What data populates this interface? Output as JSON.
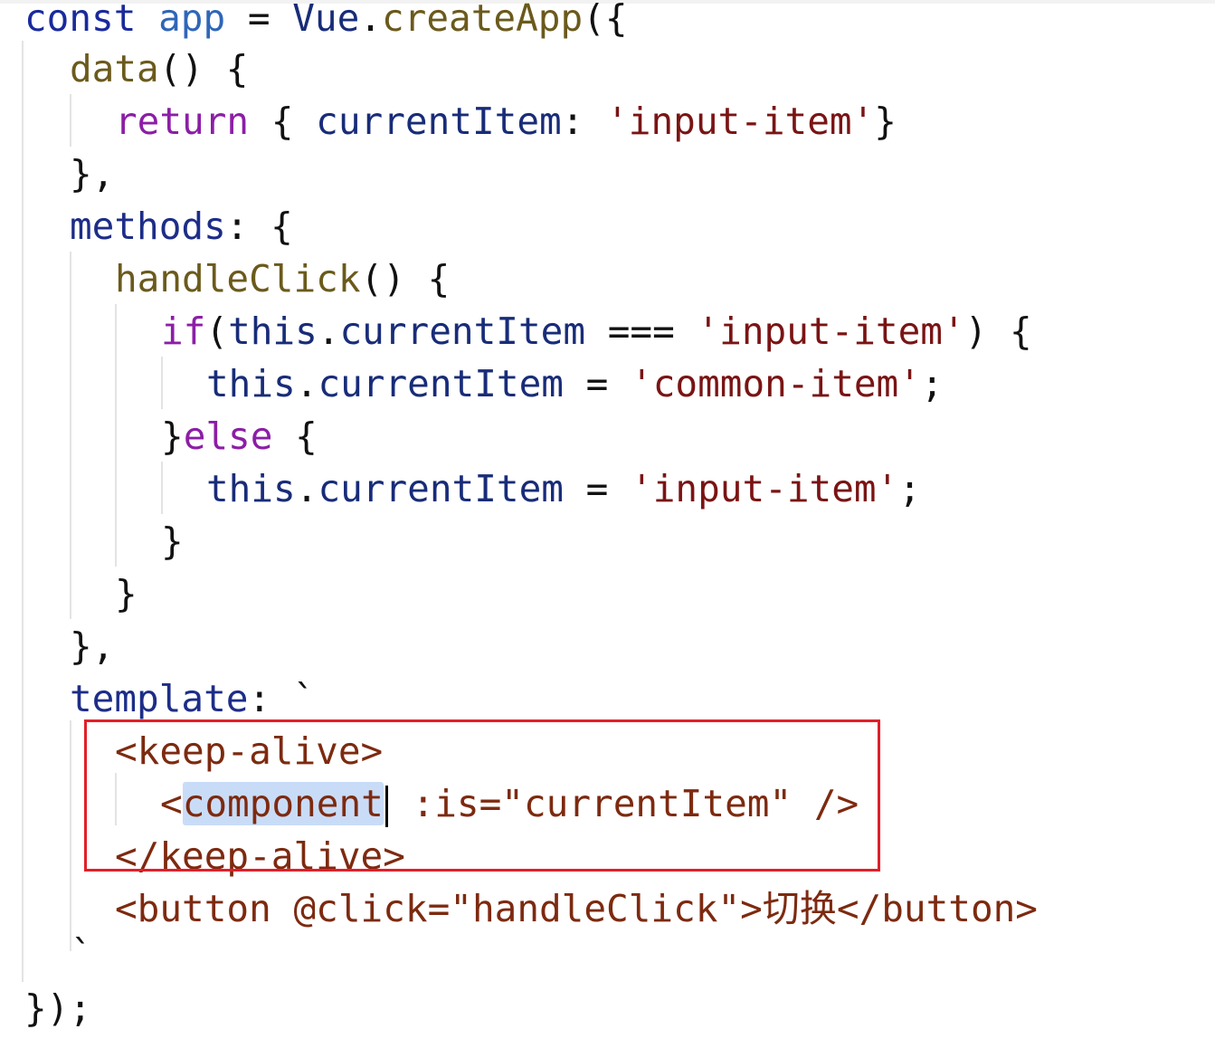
{
  "code": {
    "lines": [
      {
        "id": 1,
        "tokens": [
          {
            "t": "const",
            "c": "kw"
          },
          {
            "t": " ",
            "c": "punc"
          },
          {
            "t": "app",
            "c": "ident"
          },
          {
            "t": " = ",
            "c": "punc"
          },
          {
            "t": "Vue",
            "c": "obj"
          },
          {
            "t": ".",
            "c": "punc"
          },
          {
            "t": "createApp",
            "c": "fn"
          },
          {
            "t": "({",
            "c": "punc"
          }
        ]
      },
      {
        "id": 2,
        "tokens": [
          {
            "t": "data",
            "c": "fn"
          },
          {
            "t": "() {",
            "c": "punc"
          }
        ]
      },
      {
        "id": 3,
        "tokens": [
          {
            "t": "return",
            "c": "ret"
          },
          {
            "t": " { ",
            "c": "punc"
          },
          {
            "t": "currentItem",
            "c": "obj"
          },
          {
            "t": ": ",
            "c": "punc"
          },
          {
            "t": "'input-item'",
            "c": "str"
          },
          {
            "t": "}",
            "c": "punc"
          }
        ]
      },
      {
        "id": 4,
        "tokens": [
          {
            "t": "},",
            "c": "punc"
          }
        ]
      },
      {
        "id": 5,
        "tokens": [
          {
            "t": "methods",
            "c": "prop"
          },
          {
            "t": ": {",
            "c": "punc"
          }
        ]
      },
      {
        "id": 6,
        "tokens": [
          {
            "t": "handleClick",
            "c": "fn"
          },
          {
            "t": "() {",
            "c": "punc"
          }
        ]
      },
      {
        "id": 7,
        "tokens": [
          {
            "t": "if",
            "c": "ret"
          },
          {
            "t": "(",
            "c": "punc"
          },
          {
            "t": "this",
            "c": "obj"
          },
          {
            "t": ".",
            "c": "punc"
          },
          {
            "t": "currentItem",
            "c": "obj"
          },
          {
            "t": " === ",
            "c": "punc"
          },
          {
            "t": "'input-item'",
            "c": "str"
          },
          {
            "t": ") {",
            "c": "punc"
          }
        ]
      },
      {
        "id": 8,
        "tokens": [
          {
            "t": "this",
            "c": "obj"
          },
          {
            "t": ".",
            "c": "punc"
          },
          {
            "t": "currentItem",
            "c": "obj"
          },
          {
            "t": " = ",
            "c": "punc"
          },
          {
            "t": "'common-item'",
            "c": "str"
          },
          {
            "t": ";",
            "c": "punc"
          }
        ]
      },
      {
        "id": 9,
        "tokens": [
          {
            "t": "}",
            "c": "punc"
          },
          {
            "t": "else",
            "c": "ret"
          },
          {
            "t": " {",
            "c": "punc"
          }
        ]
      },
      {
        "id": 10,
        "tokens": [
          {
            "t": "this",
            "c": "obj"
          },
          {
            "t": ".",
            "c": "punc"
          },
          {
            "t": "currentItem",
            "c": "obj"
          },
          {
            "t": " = ",
            "c": "punc"
          },
          {
            "t": "'input-item'",
            "c": "str"
          },
          {
            "t": ";",
            "c": "punc"
          }
        ]
      },
      {
        "id": 11,
        "tokens": [
          {
            "t": "}",
            "c": "punc"
          }
        ]
      },
      {
        "id": 12,
        "tokens": [
          {
            "t": "}",
            "c": "punc"
          }
        ]
      },
      {
        "id": 13,
        "tokens": [
          {
            "t": "},",
            "c": "punc"
          }
        ]
      },
      {
        "id": 14,
        "tokens": [
          {
            "t": "template",
            "c": "prop"
          },
          {
            "t": ": `",
            "c": "punc"
          }
        ]
      },
      {
        "id": 15,
        "tokens": [
          {
            "t": "<keep-alive>",
            "c": "tag"
          }
        ]
      },
      {
        "id": 16,
        "tokens": [
          {
            "t": "<",
            "c": "tag"
          },
          {
            "t": "component",
            "c": "tag",
            "sel": true,
            "caret": true
          },
          {
            "t": " :is=\"currentItem\" />",
            "c": "tag"
          }
        ]
      },
      {
        "id": 17,
        "tokens": [
          {
            "t": "</keep-alive>",
            "c": "tag"
          }
        ]
      },
      {
        "id": 18,
        "tokens": [
          {
            "t": "<button @click=\"handleClick\">切换</button>",
            "c": "tag"
          }
        ]
      },
      {
        "id": 19,
        "tokens": [
          {
            "t": "`",
            "c": "punc"
          }
        ]
      },
      {
        "id": 20,
        "tokens": [
          {
            "t": "});",
            "c": "punc"
          }
        ]
      }
    ]
  },
  "annotation": {
    "box_color": "#e0202a"
  }
}
